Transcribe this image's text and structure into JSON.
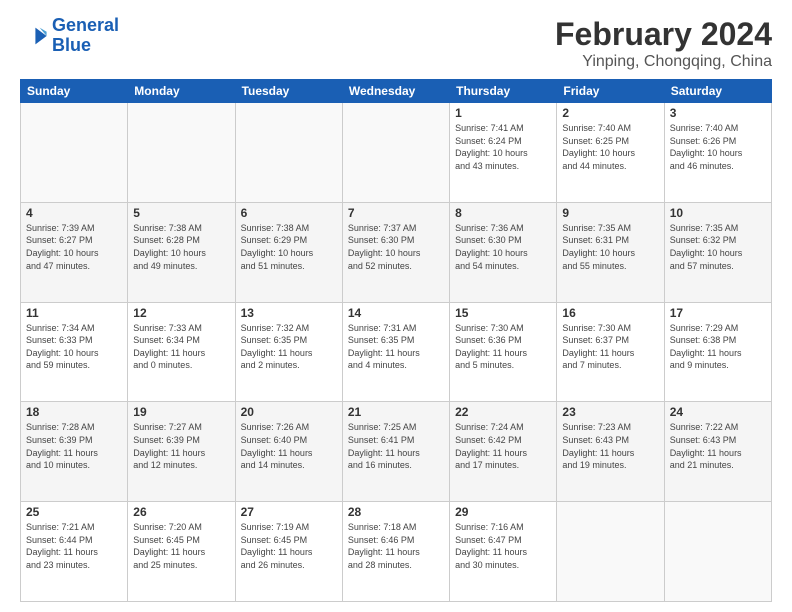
{
  "header": {
    "logo_line1": "General",
    "logo_line2": "Blue",
    "title": "February 2024",
    "subtitle": "Yinping, Chongqing, China"
  },
  "days_of_week": [
    "Sunday",
    "Monday",
    "Tuesday",
    "Wednesday",
    "Thursday",
    "Friday",
    "Saturday"
  ],
  "weeks": [
    [
      {
        "day": "",
        "info": ""
      },
      {
        "day": "",
        "info": ""
      },
      {
        "day": "",
        "info": ""
      },
      {
        "day": "",
        "info": ""
      },
      {
        "day": "1",
        "info": "Sunrise: 7:41 AM\nSunset: 6:24 PM\nDaylight: 10 hours\nand 43 minutes."
      },
      {
        "day": "2",
        "info": "Sunrise: 7:40 AM\nSunset: 6:25 PM\nDaylight: 10 hours\nand 44 minutes."
      },
      {
        "day": "3",
        "info": "Sunrise: 7:40 AM\nSunset: 6:26 PM\nDaylight: 10 hours\nand 46 minutes."
      }
    ],
    [
      {
        "day": "4",
        "info": "Sunrise: 7:39 AM\nSunset: 6:27 PM\nDaylight: 10 hours\nand 47 minutes."
      },
      {
        "day": "5",
        "info": "Sunrise: 7:38 AM\nSunset: 6:28 PM\nDaylight: 10 hours\nand 49 minutes."
      },
      {
        "day": "6",
        "info": "Sunrise: 7:38 AM\nSunset: 6:29 PM\nDaylight: 10 hours\nand 51 minutes."
      },
      {
        "day": "7",
        "info": "Sunrise: 7:37 AM\nSunset: 6:30 PM\nDaylight: 10 hours\nand 52 minutes."
      },
      {
        "day": "8",
        "info": "Sunrise: 7:36 AM\nSunset: 6:30 PM\nDaylight: 10 hours\nand 54 minutes."
      },
      {
        "day": "9",
        "info": "Sunrise: 7:35 AM\nSunset: 6:31 PM\nDaylight: 10 hours\nand 55 minutes."
      },
      {
        "day": "10",
        "info": "Sunrise: 7:35 AM\nSunset: 6:32 PM\nDaylight: 10 hours\nand 57 minutes."
      }
    ],
    [
      {
        "day": "11",
        "info": "Sunrise: 7:34 AM\nSunset: 6:33 PM\nDaylight: 10 hours\nand 59 minutes."
      },
      {
        "day": "12",
        "info": "Sunrise: 7:33 AM\nSunset: 6:34 PM\nDaylight: 11 hours\nand 0 minutes."
      },
      {
        "day": "13",
        "info": "Sunrise: 7:32 AM\nSunset: 6:35 PM\nDaylight: 11 hours\nand 2 minutes."
      },
      {
        "day": "14",
        "info": "Sunrise: 7:31 AM\nSunset: 6:35 PM\nDaylight: 11 hours\nand 4 minutes."
      },
      {
        "day": "15",
        "info": "Sunrise: 7:30 AM\nSunset: 6:36 PM\nDaylight: 11 hours\nand 5 minutes."
      },
      {
        "day": "16",
        "info": "Sunrise: 7:30 AM\nSunset: 6:37 PM\nDaylight: 11 hours\nand 7 minutes."
      },
      {
        "day": "17",
        "info": "Sunrise: 7:29 AM\nSunset: 6:38 PM\nDaylight: 11 hours\nand 9 minutes."
      }
    ],
    [
      {
        "day": "18",
        "info": "Sunrise: 7:28 AM\nSunset: 6:39 PM\nDaylight: 11 hours\nand 10 minutes."
      },
      {
        "day": "19",
        "info": "Sunrise: 7:27 AM\nSunset: 6:39 PM\nDaylight: 11 hours\nand 12 minutes."
      },
      {
        "day": "20",
        "info": "Sunrise: 7:26 AM\nSunset: 6:40 PM\nDaylight: 11 hours\nand 14 minutes."
      },
      {
        "day": "21",
        "info": "Sunrise: 7:25 AM\nSunset: 6:41 PM\nDaylight: 11 hours\nand 16 minutes."
      },
      {
        "day": "22",
        "info": "Sunrise: 7:24 AM\nSunset: 6:42 PM\nDaylight: 11 hours\nand 17 minutes."
      },
      {
        "day": "23",
        "info": "Sunrise: 7:23 AM\nSunset: 6:43 PM\nDaylight: 11 hours\nand 19 minutes."
      },
      {
        "day": "24",
        "info": "Sunrise: 7:22 AM\nSunset: 6:43 PM\nDaylight: 11 hours\nand 21 minutes."
      }
    ],
    [
      {
        "day": "25",
        "info": "Sunrise: 7:21 AM\nSunset: 6:44 PM\nDaylight: 11 hours\nand 23 minutes."
      },
      {
        "day": "26",
        "info": "Sunrise: 7:20 AM\nSunset: 6:45 PM\nDaylight: 11 hours\nand 25 minutes."
      },
      {
        "day": "27",
        "info": "Sunrise: 7:19 AM\nSunset: 6:45 PM\nDaylight: 11 hours\nand 26 minutes."
      },
      {
        "day": "28",
        "info": "Sunrise: 7:18 AM\nSunset: 6:46 PM\nDaylight: 11 hours\nand 28 minutes."
      },
      {
        "day": "29",
        "info": "Sunrise: 7:16 AM\nSunset: 6:47 PM\nDaylight: 11 hours\nand 30 minutes."
      },
      {
        "day": "",
        "info": ""
      },
      {
        "day": "",
        "info": ""
      }
    ]
  ]
}
